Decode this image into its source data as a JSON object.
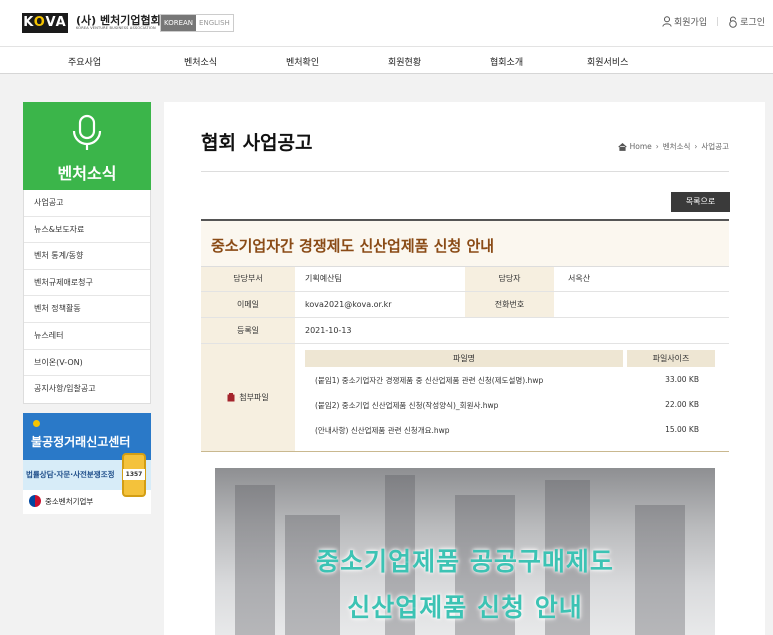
{
  "header": {
    "logo_text": "KOVA",
    "org_name": "(사) 벤처기업협회",
    "org_name_en": "KOREA VENTURE BUSINESS ASSOCIATION",
    "lang_ko": "KOREAN",
    "lang_en": "ENGLISH",
    "signup": "회원가입",
    "login": "로그인"
  },
  "nav": [
    "주요사업",
    "벤처소식",
    "벤처확인",
    "회원현황",
    "협회소개",
    "회원서비스"
  ],
  "sidebar": {
    "title": "벤처소식",
    "items": [
      "사업공고",
      "뉴스&보도자료",
      "벤처 통계/동향",
      "벤처규제애로청구",
      "벤처 정책활동",
      "뉴스레터",
      "브이온(V-ON)",
      "공지사항/입찰공고"
    ]
  },
  "banner": {
    "title": "불공정거래신고센터",
    "desc": "법률상담·자문·사전분쟁조정",
    "phone": "1357",
    "ministry": "중소벤처기업부"
  },
  "page": {
    "title": "협회 사업공고",
    "breadcrumb": [
      "Home",
      "벤처소식",
      "사업공고"
    ],
    "list_button": "목록으로"
  },
  "article": {
    "title": "중소기업자간 경쟁제도 신산업제품 신청 안내",
    "dept_label": "담당부서",
    "dept": "기획예산팀",
    "person_label": "담당자",
    "person": "서옥산",
    "email_label": "이메일",
    "email": "kova2021@kova.or.kr",
    "phone_label": "전화번호",
    "phone": "",
    "date_label": "등록일",
    "date": "2021-10-13",
    "files_label": "첨부파일",
    "file_col_name": "파일명",
    "file_col_size": "파일사이즈",
    "files": [
      {
        "name": "(붙임1) 중소기업자간 경쟁제품 중 신산업제품 관련 신청(제도설명).hwp",
        "size": "33.00 KB"
      },
      {
        "name": "(붙임2) 중소기업 신산업제품 신청(작성양식)_회원사.hwp",
        "size": "22.00 KB"
      },
      {
        "name": "(안내사항) 신산업제품 관련 신청개요.hwp",
        "size": "15.00 KB"
      }
    ]
  },
  "poster": {
    "line1": "중소기업제품 공공구매제도",
    "line2": "신산업제품 신청 안내"
  },
  "colors": {
    "green": "#3bb54a",
    "title_brown": "#8a4b16",
    "poster_teal": "#3cc3b4"
  }
}
